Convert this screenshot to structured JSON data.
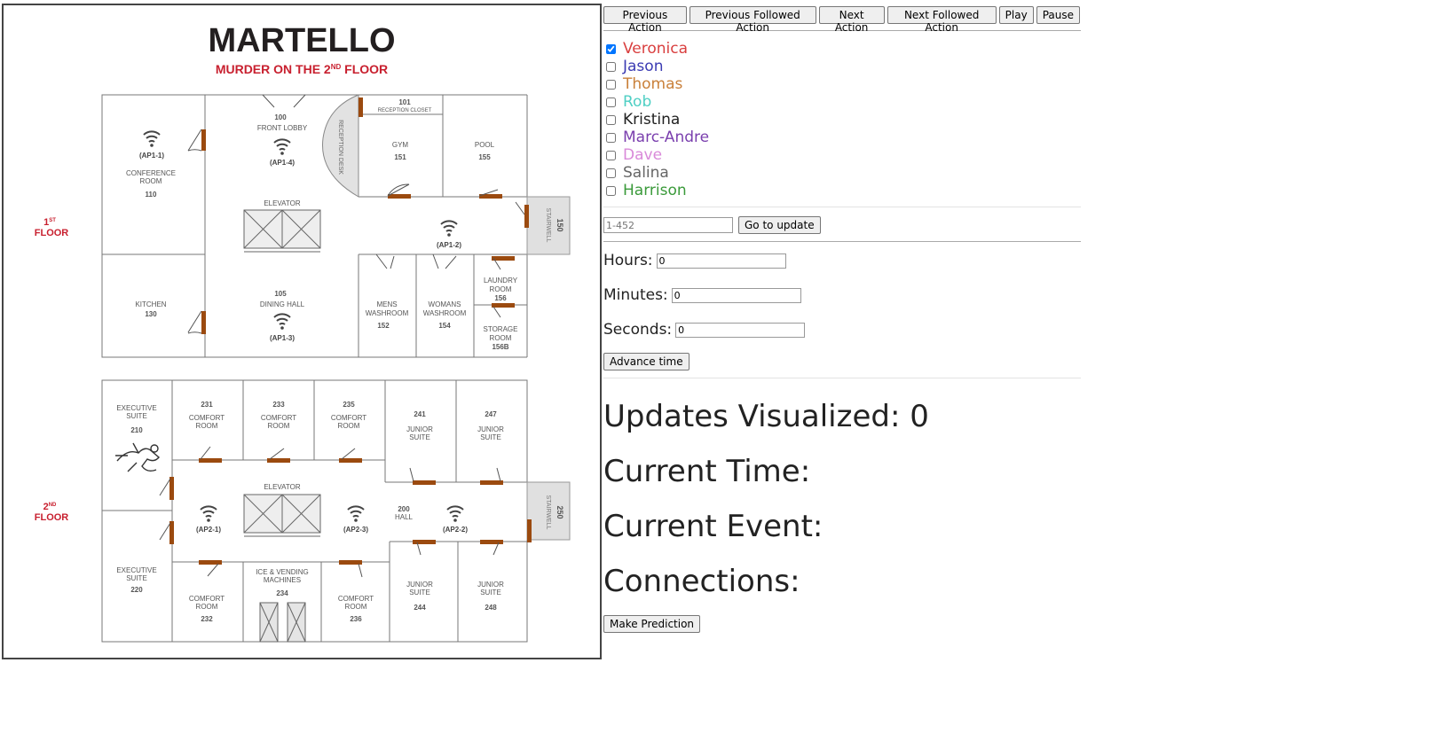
{
  "map": {
    "logo": "MARTELLO",
    "subtitle_prefix": "MURDER ON THE 2",
    "subtitle_sup": "ND",
    "subtitle_suffix": " FLOOR",
    "floor1_num": "1",
    "floor1_sup": "ST",
    "floor1_word": "FLOOR",
    "floor2_num": "2",
    "floor2_sup": "ND",
    "floor2_word": "FLOOR",
    "rooms": {
      "r100": [
        "100",
        "FRONT LOBBY"
      ],
      "r101": [
        "101",
        "RECEPTION CLOSET"
      ],
      "reception_desk": "RECEPTION DESK",
      "r110": [
        "CONFERENCE",
        "ROOM",
        "110"
      ],
      "r151": [
        "GYM",
        "151"
      ],
      "r155": [
        "POOL",
        "155"
      ],
      "r150": [
        "150",
        "STAIRWELL"
      ],
      "elevator1": "ELEVATOR",
      "r130": [
        "KITCHEN",
        "130"
      ],
      "r105": [
        "105",
        "DINING HALL"
      ],
      "r152": [
        "MENS",
        "WASHROOM",
        "152"
      ],
      "r154": [
        "WOMANS",
        "WASHROOM",
        "154"
      ],
      "r156": [
        "LAUNDRY",
        "ROOM",
        "156"
      ],
      "r156b": [
        "STORAGE",
        "ROOM",
        "156B"
      ],
      "r210": [
        "EXECUTIVE",
        "SUITE",
        "210"
      ],
      "r231": [
        "231",
        "COMFORT",
        "ROOM"
      ],
      "r233": [
        "233",
        "COMFORT",
        "ROOM"
      ],
      "r235": [
        "235",
        "COMFORT",
        "ROOM"
      ],
      "r241": [
        "241",
        "JUNIOR",
        "SUITE"
      ],
      "r247": [
        "247",
        "JUNIOR",
        "SUITE"
      ],
      "elevator2": "ELEVATOR",
      "r200": [
        "200",
        "HALL"
      ],
      "r250": [
        "250",
        "STAIRWELL"
      ],
      "r220": [
        "EXECUTIVE",
        "SUITE",
        "220"
      ],
      "r232": [
        "COMFORT",
        "ROOM",
        "232"
      ],
      "r234": [
        "ICE & VENDING",
        "MACHINES",
        "234"
      ],
      "r236": [
        "COMFORT",
        "ROOM",
        "236"
      ],
      "r244": [
        "JUNIOR",
        "SUITE",
        "244"
      ],
      "r248": [
        "JUNIOR",
        "SUITE",
        "248"
      ]
    },
    "access_points": {
      "ap11": "(AP1-1)",
      "ap14": "(AP1-4)",
      "ap12": "(AP1-2)",
      "ap13": "(AP1-3)",
      "ap21": "(AP2-1)",
      "ap23": "(AP2-3)",
      "ap22": "(AP2-2)"
    },
    "colors": {
      "brand": "#c8202f",
      "logo_dark": "#231f20",
      "door": "#9b4a0f",
      "wall": "#777777",
      "stair_fill": "#e0e0e0",
      "text": "#555555"
    }
  },
  "toolbar": {
    "prev_action": "Previous Action",
    "prev_followed": "Previous Followed Action",
    "next_action": "Next Action",
    "next_followed": "Next Followed Action",
    "play": "Play",
    "pause": "Pause"
  },
  "people": [
    {
      "name": "Veronica",
      "color": "#d93f3f",
      "checked": true
    },
    {
      "name": "Jason",
      "color": "#3b3bb3",
      "checked": false
    },
    {
      "name": "Thomas",
      "color": "#c9803a",
      "checked": false
    },
    {
      "name": "Rob",
      "color": "#4fcfc4",
      "checked": false
    },
    {
      "name": "Kristina",
      "color": "#222222",
      "checked": false
    },
    {
      "name": "Marc-Andre",
      "color": "#7a3fae",
      "checked": false
    },
    {
      "name": "Dave",
      "color": "#d98ad9",
      "checked": false
    },
    {
      "name": "Salina",
      "color": "#666666",
      "checked": false
    },
    {
      "name": "Harrison",
      "color": "#3a9a3a",
      "checked": false
    }
  ],
  "update": {
    "placeholder": "1-452",
    "go_label": "Go to update"
  },
  "time": {
    "hours_label": "Hours:",
    "hours_value": "0",
    "minutes_label": "Minutes:",
    "minutes_value": "0",
    "seconds_label": "Seconds:",
    "seconds_value": "0",
    "advance_label": "Advance time"
  },
  "status": {
    "updates_label": "Updates Visualized: ",
    "updates_value": "0",
    "current_time_label": "Current Time:",
    "current_event_label": "Current Event:",
    "connections_label": "Connections:"
  },
  "predict_label": "Make Prediction"
}
